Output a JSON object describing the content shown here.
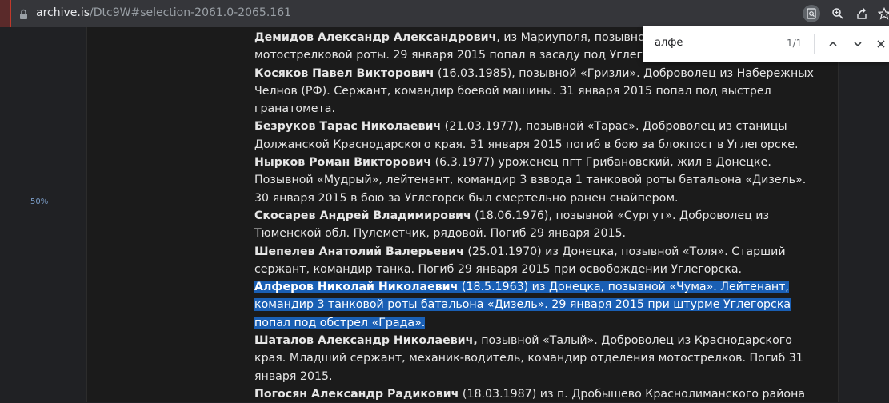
{
  "browser": {
    "url_host": "archive.is",
    "url_path": "/Dtc9W#selection-2061.0-2065.161",
    "icons": [
      "lock-icon",
      "find-in-page-icon",
      "zoom-icon",
      "share-icon",
      "star-icon"
    ]
  },
  "side_link": "50%",
  "find_bar": {
    "query": "алфе",
    "count": "1/1",
    "icons": [
      "chevron-up-icon",
      "chevron-down-icon",
      "close-icon"
    ]
  },
  "entries": [
    {
      "name": "Демидов Александр Александрович",
      "text": ", из Мариуполя, позывной «",
      "partial_top": true
    },
    {
      "name": "",
      "text": "мотострелковой роты. 29 января 2015 попал в засаду под Углегорском, у"
    },
    {
      "name": "Косяков Павел Викторович",
      "text": " (16.03.1985), позывной «Гризли». Доброволец из Набережных Челнов (РФ). Сержант, командир боевой машины. 31 января 2015 попал под выстрел гранатомета."
    },
    {
      "name": "Безруков Тарас Николаевич",
      "text": " (21.03.1977), позывной «Тарас». Доброволец из станицы Должанской Краснодарского края. 31 января 2015 погиб в бою за блокпост в Углегорске."
    },
    {
      "name": "Нырков Роман Викторович",
      "text": " (6.3.1977) уроженец пгт Грибановский, жил в Донецке. Позывной «Мудрый», лейтенант, командир 3 взвода 1 танковой роты батальона «Дизель». 30 января 2015 в бою за Углегорск был смертельно ранен снайпером."
    },
    {
      "name": "Скосарев Андрей Владимирович",
      "text": " (18.06.1976), позывной «Сургут». Доброволец из Тюменской обл. Пулеметчик, рядовой. Погиб 29 января 2015."
    },
    {
      "name": "Шепелев Анатолий Валерьевич",
      "text": " (25.01.1970) из Донецка, позывной «Толя». Старший сержант, командир танка. Погиб 29 января 2015 при освобождении Углегорска."
    },
    {
      "name": "Алферов Николай Николаевич",
      "text": " (18.5.1963) из Донецка, позывной «Чума». Лейтенант, командир 3 танковой роты батальона «Дизель». 29 января 2015 при штурме Углегорска попал под обстрел «Града».",
      "selected": true
    },
    {
      "name": "Шаталов Александр Николаевич,",
      "text": " позывной «Талый». Доброволец из Краснодарского края. Младший сержант, механик-водитель, командир отделения мотострелков. Погиб 31 января 2015."
    },
    {
      "name": "Погосян Александр Радикович",
      "text": " (18.03.1987) из п. Дробышево Краснолиманского района"
    }
  ]
}
